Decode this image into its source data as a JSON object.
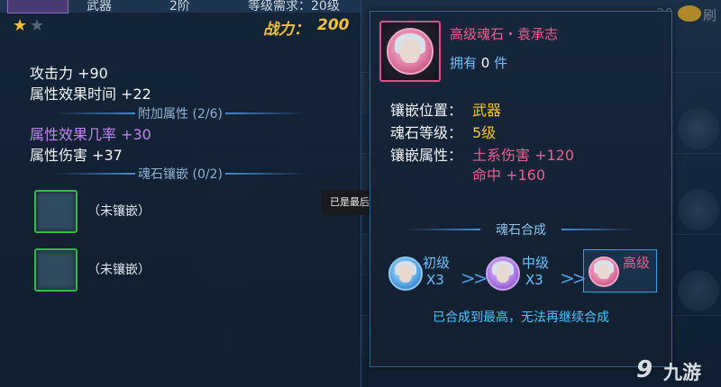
{
  "header": {
    "item_type": "武器",
    "item_stage": "2阶",
    "level_req": "等级需求：20级",
    "stars_filled": 1,
    "stars_total": 2,
    "power_label": "战力：",
    "power_value": "200"
  },
  "base_stats": [
    {
      "label": "攻击力 +90"
    },
    {
      "label": "属性效果时间 +22"
    }
  ],
  "extra_section": {
    "title": "附加属性 (2/6)",
    "stats": [
      {
        "label": "属性效果几率 +30",
        "color": "#c084f0"
      },
      {
        "label": "属性伤害 +37",
        "color": "#f0f4f8"
      }
    ]
  },
  "soul_section": {
    "title": "魂石镶嵌 (0/2)",
    "slots": [
      {
        "label": "（未镶嵌）"
      },
      {
        "label": "（未镶嵌）"
      }
    ]
  },
  "tooltip": "已是最后一张",
  "detail": {
    "title": "高级魂石・袁承志",
    "own_label": "拥有",
    "own_count": "0",
    "own_unit": "件",
    "position_label": "镶嵌位置：",
    "position_value": "武器",
    "level_label": "魂石等级：",
    "level_value": "5级",
    "attr_label": "镶嵌属性：",
    "attr_values": [
      "土系伤害 +120",
      "命中 +160"
    ],
    "synth_title": "魂石合成",
    "tiers": [
      {
        "name": "初级",
        "count": "X3"
      },
      {
        "name": "中级",
        "count": "X3"
      },
      {
        "name": "高级",
        "count": ""
      }
    ],
    "note": "已合成到最高，无法再继续合成"
  },
  "background": {
    "top_right_number": "20",
    "top_right_text": "刷"
  },
  "logo": {
    "text": "九游",
    "mark": "9"
  },
  "colors": {
    "gold": "#f2c23a",
    "pink": "#f25c92",
    "blue": "#6ec1ff",
    "purple": "#c084f0",
    "slot_green": "#38b84a"
  }
}
